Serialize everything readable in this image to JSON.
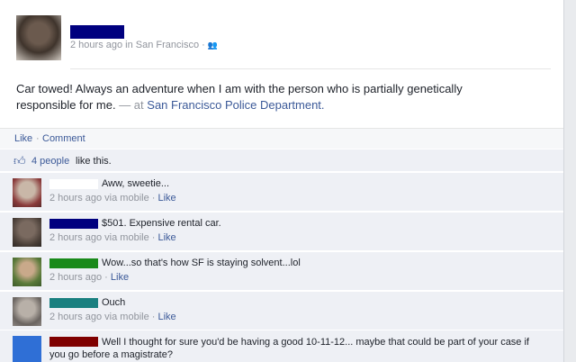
{
  "post": {
    "time": "2 hours ago",
    "location_prefix": "in",
    "location": "San Francisco",
    "separator": "·",
    "status_text": "Car towed! Always an adventure when I am with the person who is partially genetically responsible for me.",
    "at_prefix": "— at",
    "place": "San Francisco Police Department."
  },
  "actions": {
    "like_label": "Like",
    "separator": "·",
    "comment_label": "Comment"
  },
  "likes": {
    "count_label": "4 people",
    "suffix": "like this."
  },
  "comments": [
    {
      "text": "Aww, sweetie...",
      "time": "2 hours ago",
      "via": "via mobile",
      "separator": "·",
      "like_label": "Like"
    },
    {
      "text": "$501. Expensive rental car.",
      "time": "2 hours ago",
      "via": "via mobile",
      "separator": "·",
      "like_label": "Like"
    },
    {
      "text": "Wow...so that's how SF is staying solvent...lol",
      "time": "2 hours ago",
      "via": "",
      "separator": "·",
      "like_label": "Like"
    },
    {
      "text": "Ouch",
      "time": "2 hours ago",
      "via": "via mobile",
      "separator": "·",
      "like_label": "Like"
    },
    {
      "text": "Well I thought for sure you'd be having a good 10-11-12... maybe that could be part of your case if you go before a magistrate?"
    }
  ],
  "colors": {
    "link": "#3b5998",
    "redaction_post": "#00007f",
    "redaction_comments": [
      "#ffffff",
      "#00007f",
      "#1a8a1a",
      "#1a8080",
      "#7f0000"
    ]
  }
}
